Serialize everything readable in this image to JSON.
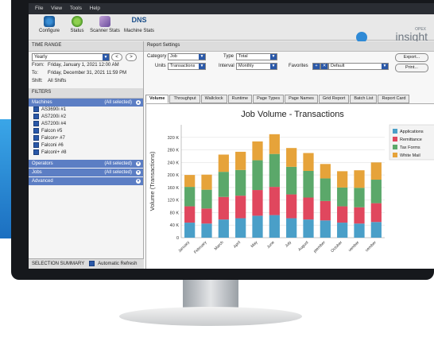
{
  "menu": [
    "File",
    "View",
    "Tools",
    "Help"
  ],
  "toolbar": {
    "configure": "Configure",
    "status": "Status",
    "scanner_stats": "Scanner Stats",
    "ns_logo": "DNS",
    "machine_stats": "Machine Stats"
  },
  "brand": {
    "small": "OPEX",
    "large": "insight"
  },
  "time_range": {
    "header": "TIME RANGE",
    "selected": "Yearly",
    "from_label": "From:",
    "from_value": "Friday, January 1, 2021 12:00 AM",
    "to_label": "To:",
    "to_value": "Friday, December 31, 2021 11:59 PM",
    "shift_label": "Shift:",
    "shift_value": "All Shifts"
  },
  "filters": {
    "header": "FILTERS",
    "machines_label": "Machines",
    "all_selected": "(All selected)",
    "machines": [
      "AS3690i #1",
      "AS7200i #2",
      "AS7200i #4",
      "Falcon #5",
      "Falcon+ #7",
      "Falconi #6",
      "FalconI+ #8"
    ],
    "operators_label": "Operators",
    "jobs_label": "Jobs",
    "advanced_label": "Advanced"
  },
  "summary": {
    "label": "SELECTION SUMMARY",
    "auto_refresh": "Automatic Refresh"
  },
  "report_settings": {
    "header": "Report Settings",
    "category_label": "Category",
    "category_value": "Job",
    "type_label": "Type",
    "type_value": "Total",
    "units_label": "Units",
    "units_value": "Transactions",
    "interval_label": "Interval",
    "interval_value": "Monthly",
    "favorites_label": "Favorites",
    "favorites_value": "Default",
    "export_label": "Export...",
    "print_label": "Print..."
  },
  "tabs": [
    "Volume",
    "Throughput",
    "Wallclock",
    "Runtime",
    "Page Types",
    "Page Names",
    "Grid Report",
    "Batch List",
    "Report Card"
  ],
  "colors": {
    "applications": "#4a9fc8",
    "remittance": "#e0475e",
    "tax_forms": "#5ba86a",
    "white_mail": "#e6a33a"
  },
  "chart_data": {
    "type": "bar",
    "stacked": true,
    "title": "Job Volume - Transactions",
    "ylabel": "Volume (Transactions)",
    "xlabel": "",
    "ylim": [
      0,
      360
    ],
    "yticks": [
      0,
      40,
      80,
      120,
      160,
      200,
      240,
      280,
      320
    ],
    "ytick_labels": [
      "0",
      "40 K",
      "80 K",
      "120 K",
      "160 K",
      "200 K",
      "240 K",
      "280 K",
      "320 K"
    ],
    "categories": [
      "January",
      "February",
      "March",
      "April",
      "May",
      "June",
      "July",
      "August",
      "September",
      "October",
      "November",
      "December"
    ],
    "category_labels_visible": [
      "January",
      "February",
      "March",
      "April",
      "May",
      "June",
      "July",
      "August",
      "ptember",
      "October",
      "vember",
      "cember"
    ],
    "series": [
      {
        "name": "Applications",
        "values": [
          48,
          45,
          58,
          62,
          70,
          72,
          62,
          58,
          55,
          48,
          45,
          50
        ]
      },
      {
        "name": "Remittance",
        "values": [
          52,
          48,
          72,
          72,
          82,
          90,
          76,
          70,
          62,
          52,
          52,
          60
        ]
      },
      {
        "name": "Tax Forms",
        "values": [
          62,
          60,
          80,
          82,
          95,
          105,
          88,
          85,
          72,
          60,
          62,
          75
        ]
      },
      {
        "name": "White Mail",
        "values": [
          38,
          48,
          55,
          58,
          60,
          63,
          60,
          57,
          46,
          52,
          56,
          55
        ]
      }
    ]
  }
}
